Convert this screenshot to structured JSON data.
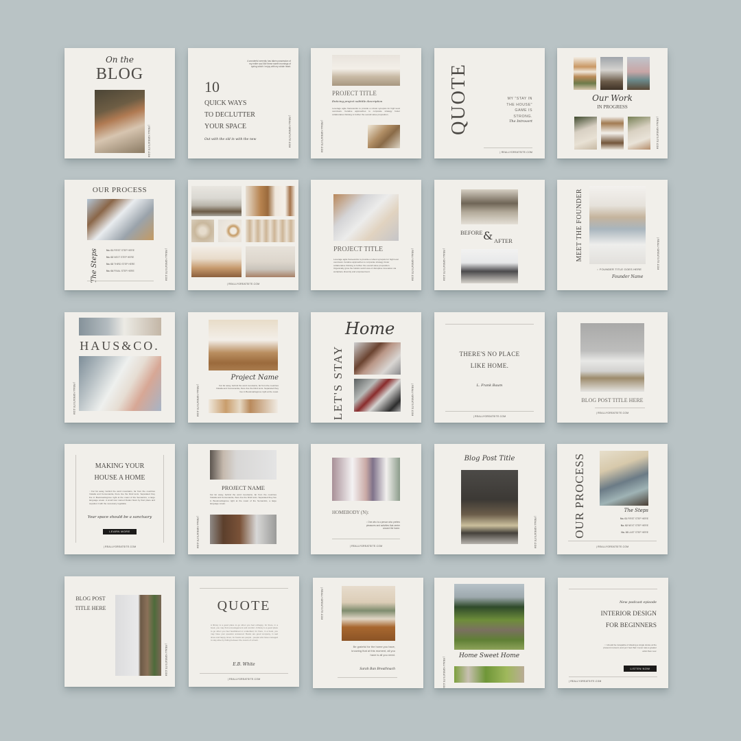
{
  "page": {
    "background": "#b9c3c5",
    "card_background": "#f1efea",
    "website": "| REALLYGREATSITE.COM"
  },
  "cards": {
    "c1": {
      "script": "On the",
      "title": "BLOG",
      "photo": "woman-with-fur-pillow-photo"
    },
    "c2": {
      "number": "10",
      "title_lines": [
        "QUICK WAYS",
        "TO DECLUTTER",
        "YOUR SPACE"
      ],
      "blurb": "A wonderful serenity has taken possession of my entire soul like these sweet mornings of spring which I enjoy with my whole heart.",
      "tagline": "Out with the old in with the new"
    },
    "c3": {
      "title": "PROJECT TITLE",
      "subtitle": "Enticing project subtitle description",
      "body": "Leverage agile frameworks to provide a robust synopsis for high level overviews. Iterative approaches to corporate strategy foster collaborative thinking to further the overall value proposition."
    },
    "c4": {
      "title": "QUOTE",
      "quote": "MY \"STAY IN THE HOUSE\" GAME IS STRONG.",
      "author": "The Introvert"
    },
    "c5": {
      "script": "Our Work",
      "title": "IN PROGRESS"
    },
    "c6": {
      "title": "OUR PROCESS",
      "script": "The Steps",
      "steps": [
        {
          "no": "No. 01",
          "label": "FIRST STEP HERE"
        },
        {
          "no": "No. 02",
          "label": "NEXT STEP HERE"
        },
        {
          "no": "No. 03",
          "label": "THIRD STEP HERE"
        },
        {
          "no": "No. 04",
          "label": "FINAL STEP HERE"
        }
      ]
    },
    "c7": {
      "caption": "| REALLYGREATSITE.COM"
    },
    "c8": {
      "title": "PROJECT TITLE",
      "body": "Leverage agile frameworks to provide a robust synopsis for high level overviews. Iterative approaches to corporate strategy foster collaborative thinking to further the overall value proposition. Organically grow the holistic world view of disruptive innovation via workplace diversity and empowerment."
    },
    "c9": {
      "before": "BEFORE",
      "amp": "&",
      "after": "AFTER"
    },
    "c10": {
      "title": "MEET THE FOUNDER",
      "role": ":: FOUNDER TITLE GOES HERE",
      "name": "Founder Name"
    },
    "c11": {
      "title": "HAUS&CO."
    },
    "c12": {
      "script": "Project Name",
      "body": "Far far away, behind the word mountains, far from the countries Vokalia and Consonantia, there live the blind texts. Separated they live in Bookmarksgrove right at the coast."
    },
    "c13": {
      "vertical": "LET'S STAY",
      "script": "Home"
    },
    "c14": {
      "quote_lines": [
        "THERE'S NO PLACE",
        "LIKE HOME."
      ],
      "author": "L. Frank Baum"
    },
    "c15": {
      "title": "BLOG POST TITLE HERE"
    },
    "c16": {
      "title_lines": [
        "MAKING YOUR",
        "HOUSE A HOME"
      ],
      "body": ":: Far far away, behind the word mountains, far from the countries Vokalia and Consonantia, there live the blind texts. Separated they live in Bookmarksgrove right at the coast of the Semantics, a large language ocean. A small river named Duden flows by their place and supplies it with the necessary regelialia.",
      "script": "Your space should be a sanctuary",
      "button": "LEARN MORE"
    },
    "c17": {
      "title": "PROJECT NAME",
      "body": "Far far away, behind the word mountains, far from the countries Vokalia and Consonantia, there live the blind texts. Separated they live in Bookmarksgrove right at the coast of the Semantics, a large language ocean."
    },
    "c18": {
      "title": "HOMEBODY (N):",
      "body": ":: One who is a person who prefers pleasures and activities that center around the home."
    },
    "c19": {
      "script": "Blog Post Title"
    },
    "c20": {
      "title": "OUR PROCESS",
      "script": "The Steps",
      "steps": [
        {
          "no": "No. 01",
          "label": "FIRST STEP HERE"
        },
        {
          "no": "No. 02",
          "label": "NEXT STEP HERE"
        },
        {
          "no": "No. 03",
          "label": "LAST STEP HERE"
        }
      ]
    },
    "c21": {
      "title_lines": [
        "BLOG POST",
        "TITLE HERE"
      ]
    },
    "c22": {
      "title": "QUOTE",
      "body": "A library is a good place to go when you feel unhappy, for there, in a book, you may find encouragement and comfort. A library is a good place to go when you feel bewildered or undecided, for there, in a book, you may have your question answered. Books are good company, in sad times and happy times, for books are people - people who have managed to stay alive by hiding between the covers of a book.",
      "author": "E.B. White"
    },
    "c23": {
      "quote": "Be grateful for the home you have, knowing that at this moment, all you have is all you need.",
      "author": "Sarah Ban Breathnach"
    },
    "c24": {
      "script": "Home Sweet Home"
    },
    "c25": {
      "script": "New podcast episode",
      "title_lines": [
        "INTERIOR DESIGN",
        "FOR BEGINNERS"
      ],
      "body": ":: I should be incapable of drawing a single stroke at the present moment; and yet I feel that I never was a greater artist than now.",
      "button": "LISTEN NOW"
    }
  }
}
